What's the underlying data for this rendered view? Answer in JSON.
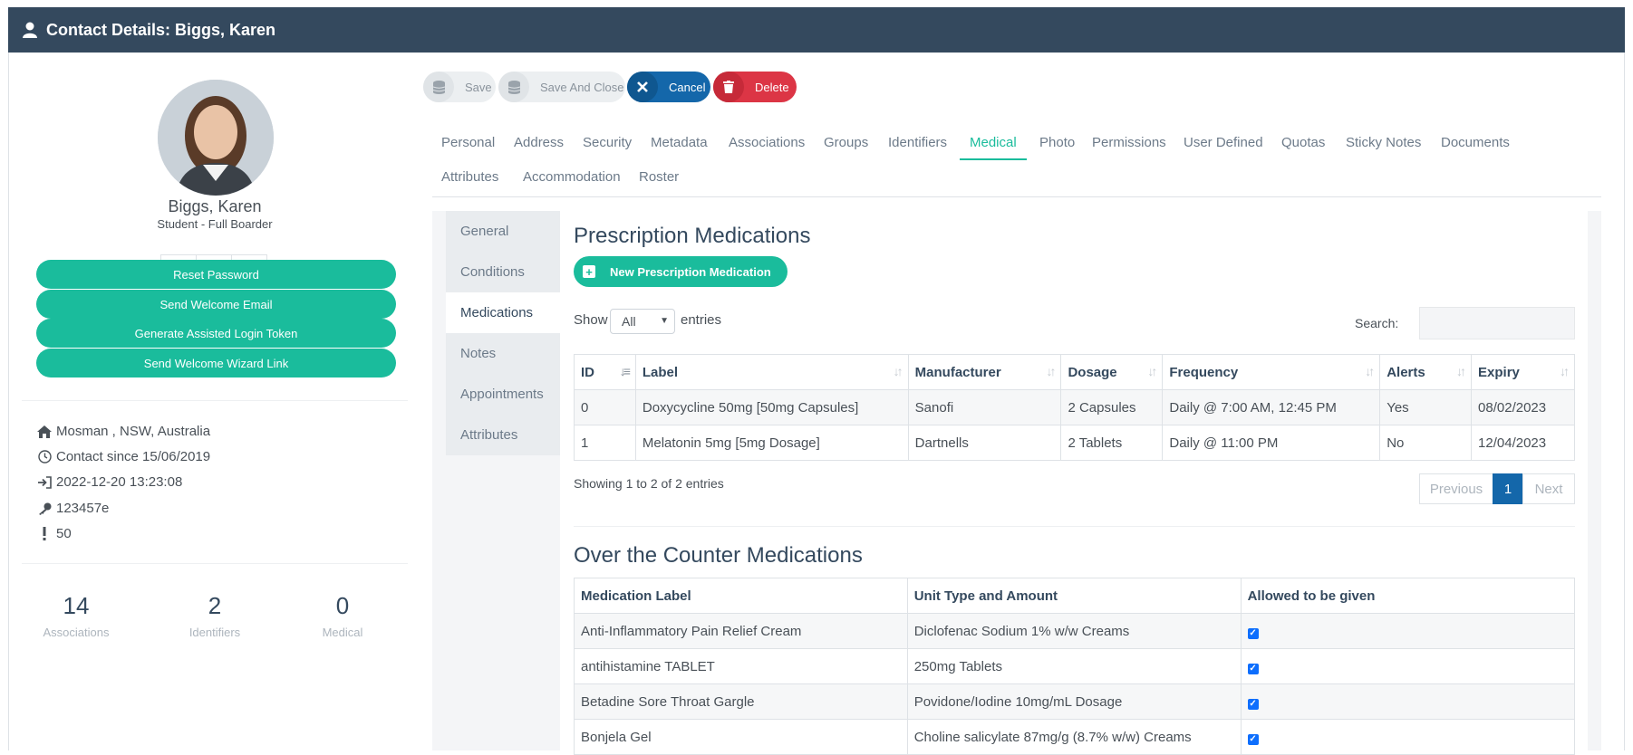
{
  "header": {
    "title": "Contact Details: Biggs, Karen"
  },
  "profile": {
    "name": "Biggs, Karen",
    "role": "Student - Full Boarder",
    "actions": [
      "Reset Password",
      "Send Welcome Email",
      "Generate Assisted Login Token",
      "Send Welcome Wizard Link"
    ],
    "info": {
      "location": "Mosman , NSW, Australia",
      "contact_since": "Contact since 15/06/2019",
      "last_login": "2022-12-20 13:23:08",
      "key": "123457e",
      "alert": "50"
    },
    "stats": [
      {
        "value": "14",
        "label": "Associations"
      },
      {
        "value": "2",
        "label": "Identifiers"
      },
      {
        "value": "0",
        "label": "Medical"
      }
    ]
  },
  "toolbar": {
    "save": "Save",
    "save_close": "Save And Close",
    "cancel": "Cancel",
    "delete": "Delete"
  },
  "tabs": [
    "Personal",
    "Address",
    "Security",
    "Metadata",
    "Associations",
    "Groups",
    "Identifiers",
    "Medical",
    "Photo",
    "Permissions",
    "User Defined",
    "Quotas",
    "Sticky Notes",
    "Documents",
    "Attributes",
    "Accommodation",
    "Roster"
  ],
  "active_tab": "Medical",
  "subnav": [
    "General",
    "Conditions",
    "Medications",
    "Notes",
    "Appointments",
    "Attributes"
  ],
  "active_subnav": "Medications",
  "prescription": {
    "heading": "Prescription Medications",
    "new_button": "New Prescription Medication",
    "show_label": "Show",
    "entries_value": "All",
    "entries_label": "entries",
    "search_label": "Search:",
    "columns": [
      "ID",
      "Label",
      "Manufacturer",
      "Dosage",
      "Frequency",
      "Alerts",
      "Expiry"
    ],
    "rows": [
      [
        "0",
        "Doxycycline 50mg [50mg Capsules]",
        "Sanofi",
        "2 Capsules",
        "Daily @ 7:00 AM, 12:45 PM",
        "Yes",
        "08/02/2023"
      ],
      [
        "1",
        "Melatonin 5mg [5mg Dosage]",
        "Dartnells",
        "2 Tablets",
        "Daily @ 11:00 PM",
        "No",
        "12/04/2023"
      ]
    ],
    "info": "Showing 1 to 2 of 2 entries",
    "pager": {
      "previous": "Previous",
      "page": "1",
      "next": "Next"
    }
  },
  "otc": {
    "heading": "Over the Counter Medications",
    "columns": [
      "Medication Label",
      "Unit Type and Amount",
      "Allowed to be given"
    ],
    "rows": [
      [
        "Anti-Inflammatory Pain Relief Cream",
        "Diclofenac Sodium 1% w/w Creams"
      ],
      [
        "antihistamine TABLET",
        "250mg Tablets"
      ],
      [
        "Betadine Sore Throat Gargle",
        "Povidone/Iodine 10mg/mL Dosage"
      ],
      [
        "Bonjela Gel",
        "Choline salicylate 87mg/g (8.7% w/w) Creams"
      ]
    ]
  },
  "colors": {
    "header": "#34495e",
    "accent": "#1abc9c",
    "primary": "#1467aa",
    "danger": "#dc3545"
  }
}
